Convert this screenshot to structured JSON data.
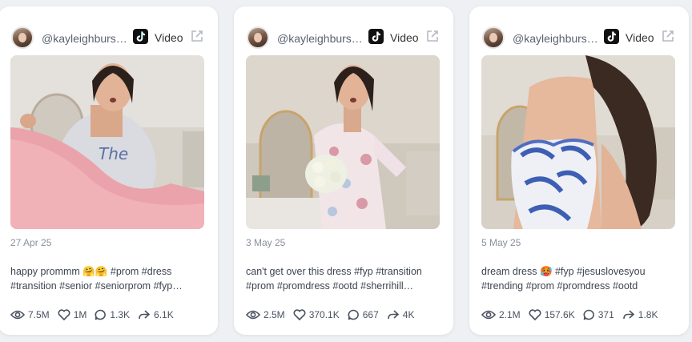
{
  "cards": [
    {
      "handle": "@kayleighburs…",
      "platform": "Video",
      "date": "27 Apr 25",
      "caption_line1": "happy prommm 🤗🤗 #prom #dress",
      "caption_line2": "#transition #senior #seniorprom #fyp…",
      "views": "7.5M",
      "likes": "1M",
      "comments": "1.3K",
      "shares": "6.1K"
    },
    {
      "handle": "@kayleighburs…",
      "platform": "Video",
      "date": "3 May 25",
      "caption_line1": "can't get over this dress #fyp #transition",
      "caption_line2": "#prom #promdress #ootd #sherrihill…",
      "views": "2.5M",
      "likes": "370.1K",
      "comments": "667",
      "shares": "4K"
    },
    {
      "handle": "@kayleighburs…",
      "platform": "Video",
      "date": "5 May 25",
      "caption_line1": "dream dress 🥵 #fyp #jesuslovesyou",
      "caption_line2": "#trending #prom #promdress #ootd",
      "views": "2.1M",
      "likes": "157.6K",
      "comments": "371",
      "shares": "1.8K"
    }
  ],
  "icons": {
    "platform": "tiktok-logo-icon",
    "external": "external-link-icon",
    "views": "eye-icon",
    "likes": "heart-icon",
    "comments": "comment-bubble-icon",
    "shares": "share-arrow-icon"
  },
  "colors": {
    "card_bg": "#ffffff",
    "page_bg": "#eef0f3",
    "muted": "#8a909a",
    "text": "#3d4450"
  }
}
